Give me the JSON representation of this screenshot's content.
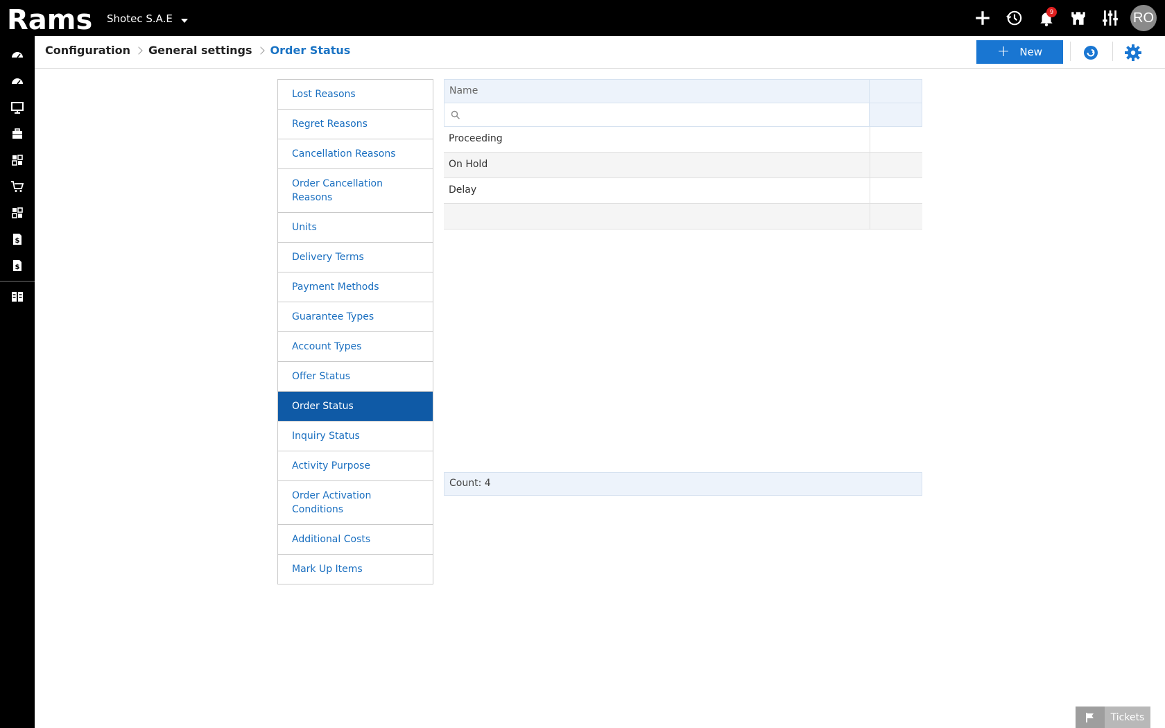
{
  "app": {
    "logo_text": "Rams",
    "company": "Shotec S.A.E",
    "notifications_count": "9",
    "user_initials": "RO"
  },
  "breadcrumb": {
    "items": [
      "Configuration",
      "General settings"
    ],
    "current": "Order Status"
  },
  "toolbar": {
    "new_label": "New"
  },
  "settings_list": [
    "Lost Reasons",
    "Regret Reasons",
    "Cancellation Reasons",
    "Order Cancellation Reasons",
    "Units",
    "Delivery Terms",
    "Payment Methods",
    "Guarantee Types",
    "Account Types",
    "Offer Status",
    "Order Status",
    "Inquiry Status",
    "Activity Purpose",
    "Order Activation Conditions",
    "Additional Costs",
    "Mark Up Items"
  ],
  "active_item": "Order Status",
  "grid": {
    "columns": [
      "Name"
    ],
    "search_placeholder": "",
    "rows": [
      "Proceeding",
      "On Hold",
      "Delay",
      ""
    ],
    "count_text": "Count: 4"
  },
  "tickets": {
    "label": "Tickets"
  },
  "colors": {
    "primary": "#1976d2",
    "active_item": "#0f5aa6",
    "link": "#1a6fc0",
    "topbar": "#000000"
  }
}
